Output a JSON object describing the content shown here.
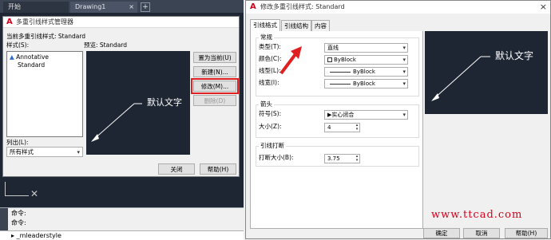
{
  "cad": {
    "tabs": [
      "开始",
      "Drawing1"
    ],
    "tab_close": "×",
    "new_tab": "+",
    "command_lines": [
      "命令:",
      "命令:"
    ],
    "command_input": "_mleaderstyle",
    "command_prompt": "▸"
  },
  "dialog1": {
    "title": "多重引线样式管理器",
    "current_style_label": "当前多重引线样式: Standard",
    "styles_label": "样式(S):",
    "styles": [
      "Annotative",
      "Standard"
    ],
    "preview_label": "预览: Standard",
    "preview_text": "默认文字",
    "list_label": "列出(L):",
    "list_value": "所有样式",
    "buttons": {
      "set_current": "置为当前(U)",
      "new": "新建(N)...",
      "modify": "修改(M)...",
      "delete": "删除(D)",
      "close": "关闭",
      "help": "帮助(H)"
    }
  },
  "dialog2": {
    "title": "修改多重引线样式: Standard",
    "tabs": [
      "引线格式",
      "引线结构",
      "内容"
    ],
    "general": {
      "group": "常规",
      "type_label": "类型(T):",
      "type_value": "直线",
      "color_label": "颜色(C):",
      "color_value": "ByBlock",
      "linetype_label": "线型(L):",
      "linetype_value": "ByBlock",
      "lineweight_label": "线宽(I):",
      "lineweight_value": "ByBlock"
    },
    "arrowhead": {
      "group": "箭头",
      "symbol_label": "符号(S):",
      "symbol_value": "实心闭合",
      "size_label": "大小(Z):",
      "size_value": "4"
    },
    "landing": {
      "group": "引线打断",
      "break_label": "打断大小(B):",
      "break_value": "3.75"
    },
    "preview_text": "默认文字",
    "buttons": {
      "ok": "确定",
      "cancel": "取消",
      "help": "帮助(H)"
    },
    "close": "×"
  },
  "watermark": "www.ttcad.com",
  "colors": {
    "canvas": "#1f2633",
    "accent_red": "#e02020",
    "watermark": "#d0021b"
  }
}
